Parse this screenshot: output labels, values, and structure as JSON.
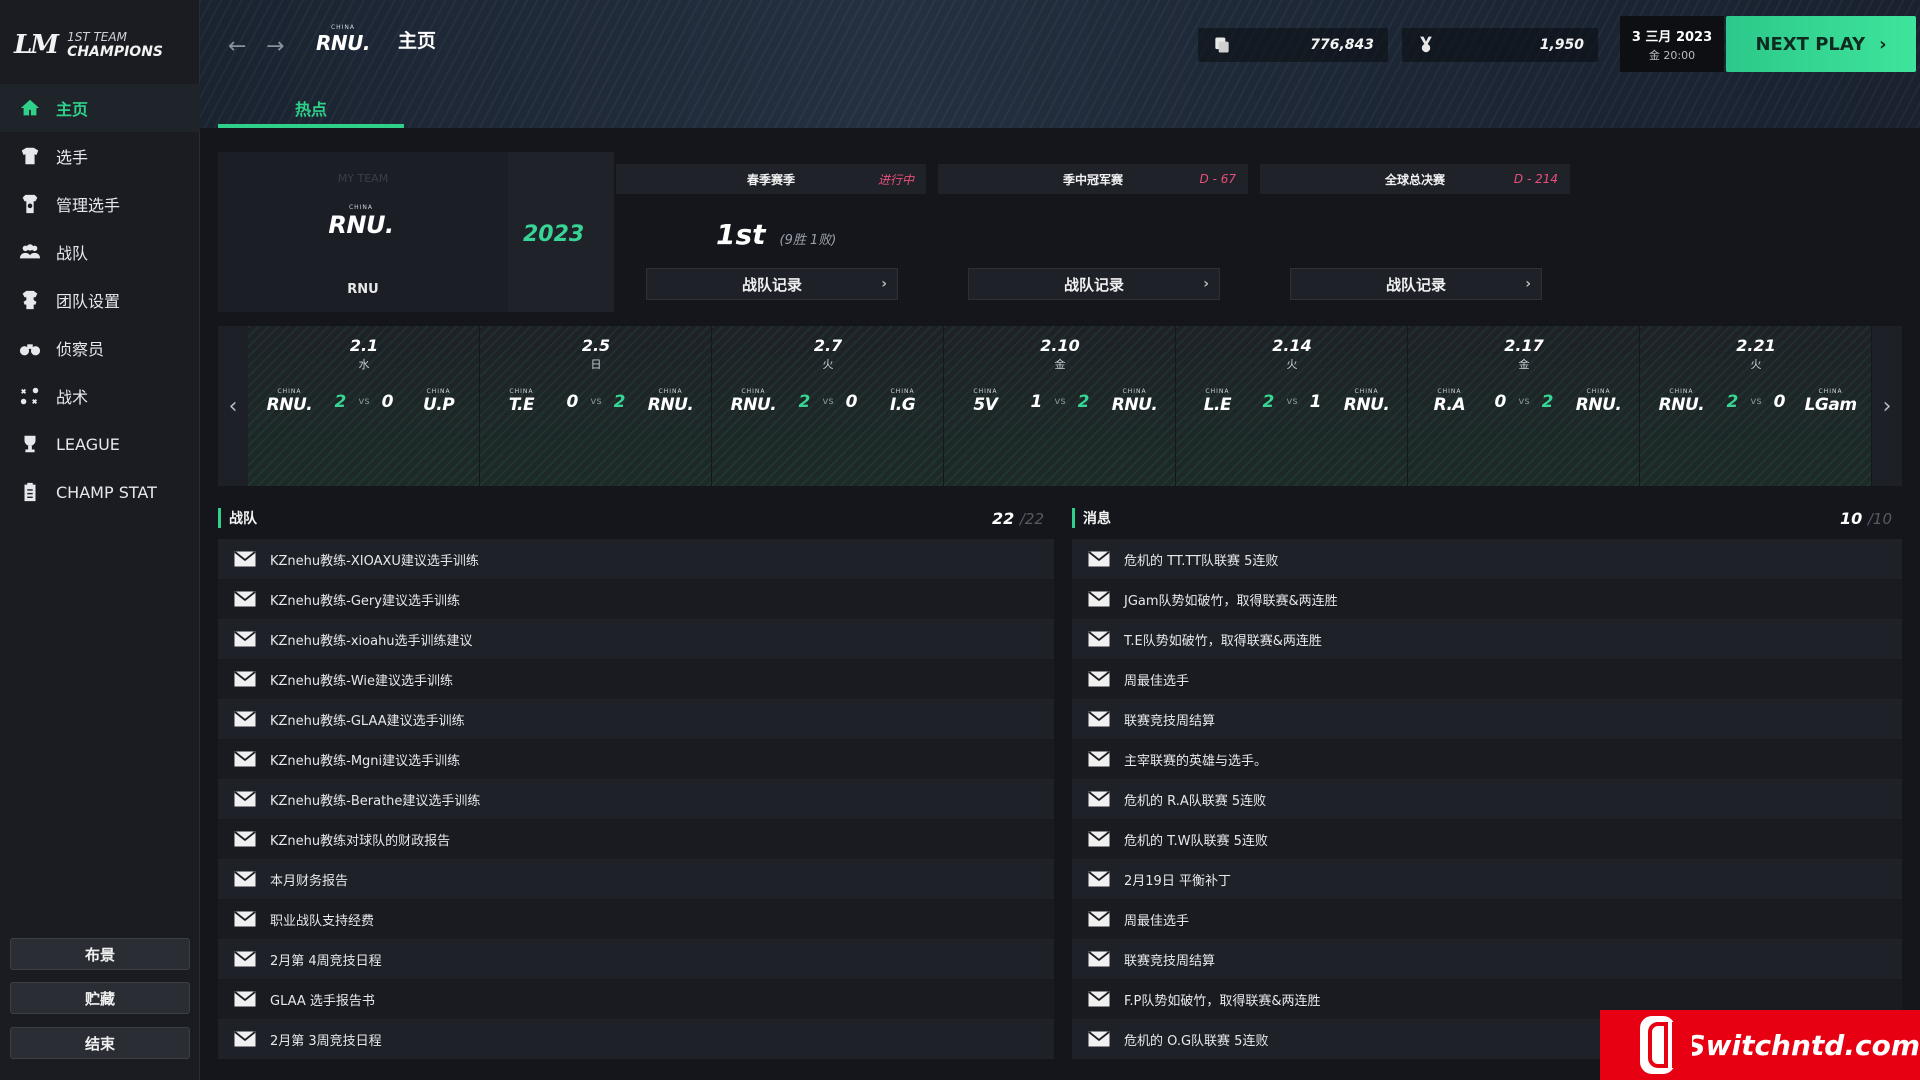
{
  "logo": {
    "mark": "LM",
    "line1": "1ST TEAM",
    "line2": "CHAMPIONS"
  },
  "nav": [
    {
      "label": "主页",
      "icon": "home-icon",
      "active": true
    },
    {
      "label": "选手",
      "icon": "jersey-icon",
      "active": false
    },
    {
      "label": "管理选手",
      "icon": "manage-player-icon",
      "active": false
    },
    {
      "label": "战队",
      "icon": "team-icon",
      "active": false
    },
    {
      "label": "团队设置",
      "icon": "team-settings-icon",
      "active": false
    },
    {
      "label": "侦察员",
      "icon": "binoculars-icon",
      "active": false
    },
    {
      "label": "战术",
      "icon": "tactics-icon",
      "active": false
    },
    {
      "label": "LEAGUE",
      "icon": "trophy-icon",
      "active": false
    },
    {
      "label": "CHAMP STAT",
      "icon": "clipboard-icon",
      "active": false
    }
  ],
  "side_buttons": [
    "布景",
    "贮藏",
    "结束"
  ],
  "header": {
    "team_china": "CHINA",
    "team_logo": "RNU.",
    "title": "主页",
    "money": "776,843",
    "fans": "1,950",
    "date_line1": "3 三月 2023",
    "date_line2": "金 20:00",
    "next_play": "NEXT PLAY",
    "tab": "热点"
  },
  "team_card": {
    "my_team": "MY TEAM",
    "logo": "RNU.",
    "name": "RNU",
    "year": "2023",
    "rank": "1st",
    "record": "(9胜 1败)"
  },
  "seasons": [
    {
      "name": "春季赛季",
      "status": "进行中",
      "record_btn": "战队记录"
    },
    {
      "name": "季中冠军赛",
      "status": "D - 67",
      "record_btn": "战队记录"
    },
    {
      "name": "全球总决赛",
      "status": "D - 214",
      "record_btn": "战队记录"
    }
  ],
  "matches": [
    {
      "date": "2.1",
      "day": "水",
      "home": "RNU.",
      "home_score": "2",
      "away": "U.P",
      "away_score": "0"
    },
    {
      "date": "2.5",
      "day": "日",
      "home": "T.E",
      "home_score": "0",
      "away": "RNU.",
      "away_score": "2"
    },
    {
      "date": "2.7",
      "day": "火",
      "home": "RNU.",
      "home_score": "2",
      "away": "I.G",
      "away_score": "0"
    },
    {
      "date": "2.10",
      "day": "金",
      "home": "5V",
      "home_score": "1",
      "away": "RNU.",
      "away_score": "2"
    },
    {
      "date": "2.14",
      "day": "火",
      "home": "L.E",
      "home_score": "2",
      "away": "RNU.",
      "away_score": "1"
    },
    {
      "date": "2.17",
      "day": "金",
      "home": "R.A",
      "home_score": "0",
      "away": "RNU.",
      "away_score": "2"
    },
    {
      "date": "2.21",
      "day": "火",
      "home": "RNU.",
      "home_score": "2",
      "away": "LGam",
      "away_score": "0"
    }
  ],
  "vs_label": "vs",
  "team_list": {
    "title": "战队",
    "count": "22",
    "total": "/22",
    "items": [
      "KZnehu教练-XIOAXU建议选手训练",
      "KZnehu教练-Gery建议选手训练",
      "KZnehu教练-xioahu选手训练建议",
      "KZnehu教练-Wie建议选手训练",
      "KZnehu教练-GLAA建议选手训练",
      "KZnehu教练-Mgni建议选手训练",
      "KZnehu教练-Berathe建议选手训练",
      "KZnehu教练对球队的财政报告",
      "本月财务报告",
      "职业战队支持经费",
      "2月第 4周竞技日程",
      "GLAA 选手报告书",
      "2月第 3周竞技日程"
    ]
  },
  "message_list": {
    "title": "消息",
    "count": "10",
    "total": "/10",
    "items": [
      "危机的 TT.TT队联赛 5连败",
      "JGam队势如破竹，取得联赛&两连胜",
      "T.E队势如破竹，取得联赛&两连胜",
      "周最佳选手",
      "联赛竞技周结算",
      "主宰联赛的英雄与选手。",
      "危机的 R.A队联赛 5连败",
      "危机的 T.W队联赛 5连败",
      "2月19日 平衡补丁",
      "周最佳选手",
      "联赛竞技周结算",
      "F.P队势如破竹，取得联赛&两连胜",
      "危机的 O.G队联赛 5连败"
    ]
  },
  "watermark": "Switchntd.com",
  "colors": {
    "accent": "#2fd08a",
    "status_pink": "#e8507a",
    "watermark_red": "#e60012"
  }
}
